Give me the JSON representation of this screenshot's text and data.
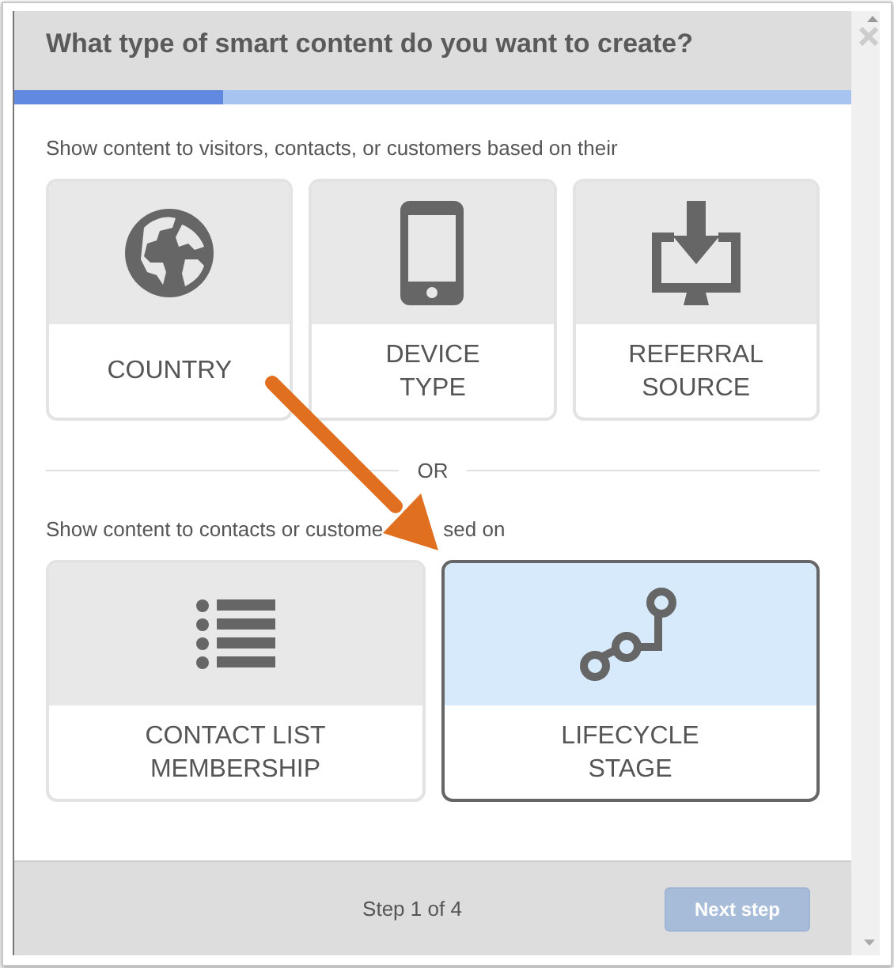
{
  "dialog": {
    "title": "What type of smart content do you want to create?",
    "progress": {
      "level": 0.25
    },
    "sections": [
      {
        "prompt": "Show content to visitors, contacts, or customers based on their",
        "options": [
          {
            "label": "COUNTRY",
            "selected": false
          },
          {
            "label": "DEVICE\nTYPE",
            "selected": false
          },
          {
            "label": "REFERRAL\nSOURCE",
            "selected": false
          }
        ]
      },
      {
        "divider": "OR",
        "prompt": "Show content to contacts or custome",
        "prompt_tail": "sed on",
        "options": [
          {
            "label": "CONTACT LIST\nMEMBERSHIP",
            "selected": false
          },
          {
            "label": "LIFECYCLE\nSTAGE",
            "selected": true
          }
        ]
      }
    ],
    "footer": {
      "step": "Step 1 of 4",
      "next_button": {
        "label": "Next step",
        "disabled": true
      }
    }
  }
}
